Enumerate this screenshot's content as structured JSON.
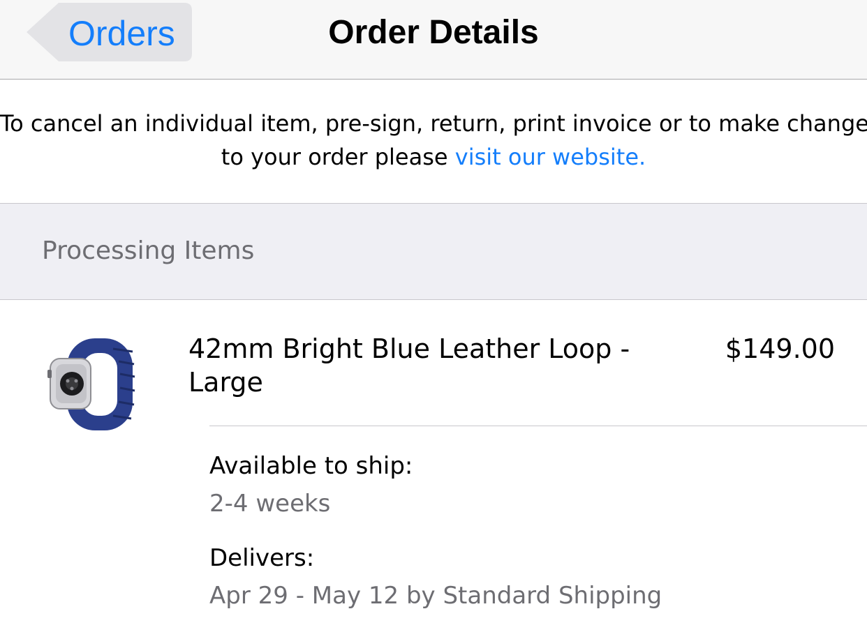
{
  "navbar": {
    "back_label": "Orders",
    "title": "Order Details"
  },
  "notice": {
    "line1": "To cancel an individual item, pre-sign, return, print invoice or to make changes",
    "line2_prefix": "to your order please ",
    "link_text": "visit our website."
  },
  "section": {
    "title": "Processing Items"
  },
  "item": {
    "name": "42mm Bright Blue Leather Loop - Large",
    "price": "$149.00",
    "thumbnail_icon": "watch-band-icon",
    "availability_label": "Available to ship:",
    "availability_value": "2-4 weeks",
    "delivery_label": "Delivers:",
    "delivery_value": "Apr 29 - May 12 by Standard Shipping"
  },
  "colors": {
    "accent": "#147efb",
    "navbar_bg": "#f7f7f7",
    "section_bg": "#efeff4",
    "secondary_text": "#6d6d72",
    "band": "#2b3f8c"
  }
}
